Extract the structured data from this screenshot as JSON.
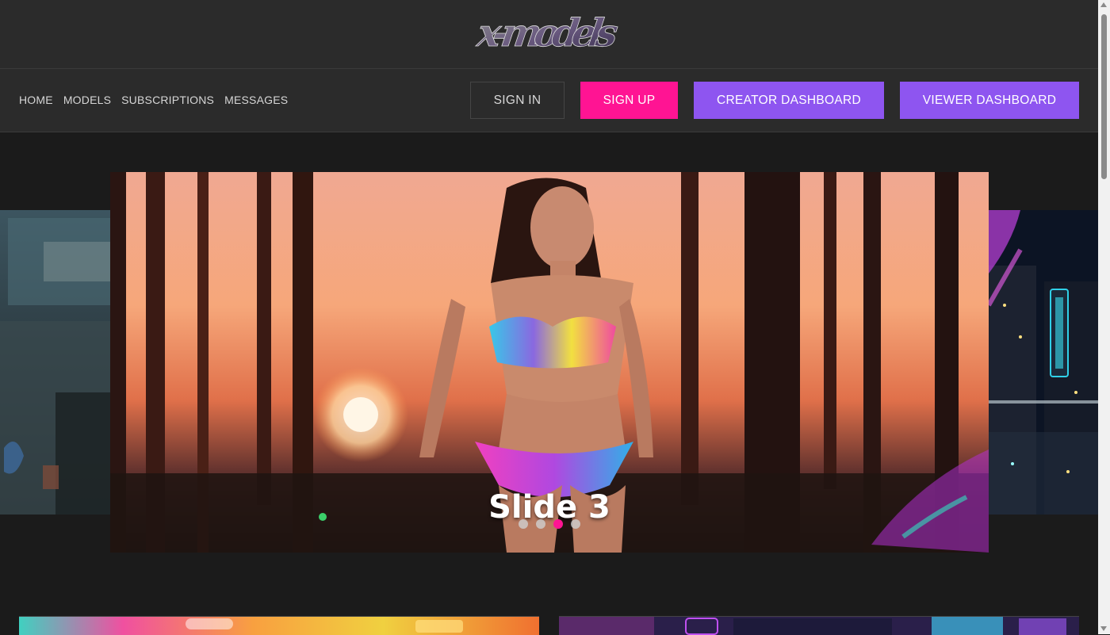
{
  "logo": {
    "text": "x-models"
  },
  "nav": {
    "links": [
      "HOME",
      "MODELS",
      "SUBSCRIPTIONS",
      "MESSAGES"
    ],
    "sign_in": "SIGN IN",
    "sign_up": "SIGN UP",
    "creator_dashboard": "CREATOR DASHBOARD",
    "viewer_dashboard": "VIEWER DASHBOARD"
  },
  "carousel": {
    "caption": "Slide 3",
    "slide_count": 4,
    "active_index": 2
  },
  "colors": {
    "accent_pink": "#ff1493",
    "accent_purple": "#8e55f0",
    "header_bg": "#2b2b2b",
    "page_bg": "#1b1b1b"
  }
}
